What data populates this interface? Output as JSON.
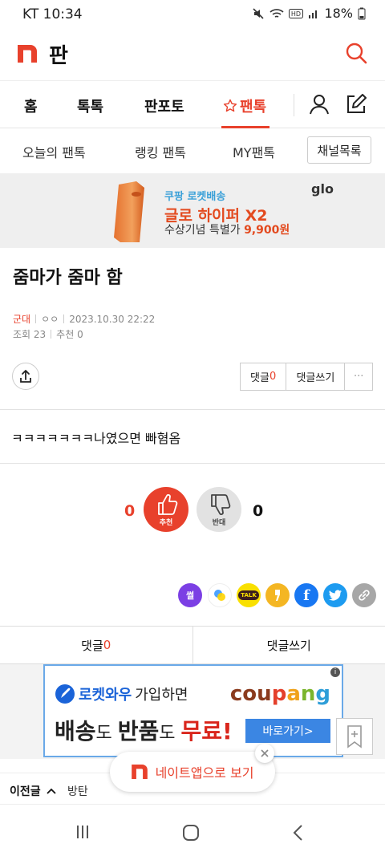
{
  "status_bar": {
    "carrier": "KT",
    "time": "10:34",
    "battery": "18%"
  },
  "header": {
    "logo_text": "판"
  },
  "main_nav": {
    "tabs": [
      "홈",
      "톡톡",
      "판포토",
      "팬톡"
    ],
    "active_tab": "팬톡"
  },
  "sub_nav": {
    "tabs": [
      "오늘의 팬톡",
      "랭킹 팬톡",
      "MY팬톡"
    ],
    "channel_button": "채널목록"
  },
  "top_ad": {
    "line1": "쿠팡 로켓배송",
    "line2": "글로 하이퍼 X2",
    "line3_prefix": "수상기념 특별가 ",
    "line3_price": "9,900원",
    "brand": "glo"
  },
  "post": {
    "title": "줌마가 줌마 함",
    "category": "군대",
    "author": "ㅇㅇ",
    "datetime": "2023.10.30 22:22",
    "views": "조회 23",
    "recommends": "추천 0",
    "body": "ㅋㅋㅋㅋㅋㅋㅋ나였으면 빠혐옴"
  },
  "actions": {
    "comment_label": "댓글",
    "comment_count": "0",
    "write_comment": "댓글쓰기",
    "more": "···"
  },
  "votes": {
    "up_count": "0",
    "up_label": "추천",
    "down_count": "0",
    "down_label": "반대"
  },
  "share_icons": [
    {
      "name": "ssul",
      "label": "썰",
      "color": "#7b3fe4"
    },
    {
      "name": "band",
      "label": "",
      "color": "#ffffff"
    },
    {
      "name": "kakaotalk",
      "label": "TALK",
      "color": "#f9e000"
    },
    {
      "name": "kakaostory",
      "label": "",
      "color": "#f4b623"
    },
    {
      "name": "facebook",
      "label": "f",
      "color": "#1877f2"
    },
    {
      "name": "twitter",
      "label": "",
      "color": "#1d9bf0"
    },
    {
      "name": "link",
      "label": "",
      "color": "#a7a7a7"
    }
  ],
  "comment_bar": {
    "comments": "댓글",
    "count": "0",
    "write": "댓글쓰기"
  },
  "bottom_ad": {
    "rocket": "로켓와우",
    "join": "가입하면",
    "brand": "coupang",
    "part1": "배송",
    "do1": "도 ",
    "part2": "반품",
    "do2": "도 ",
    "free": "무료!",
    "cta": "바로가기>"
  },
  "app_button": {
    "label": "네이트앱으로 보기"
  },
  "prev_post": {
    "label": "이전글",
    "title": "방탄"
  },
  "colors": {
    "accent": "#e8412c",
    "link_blue": "#3aa0d8"
  }
}
